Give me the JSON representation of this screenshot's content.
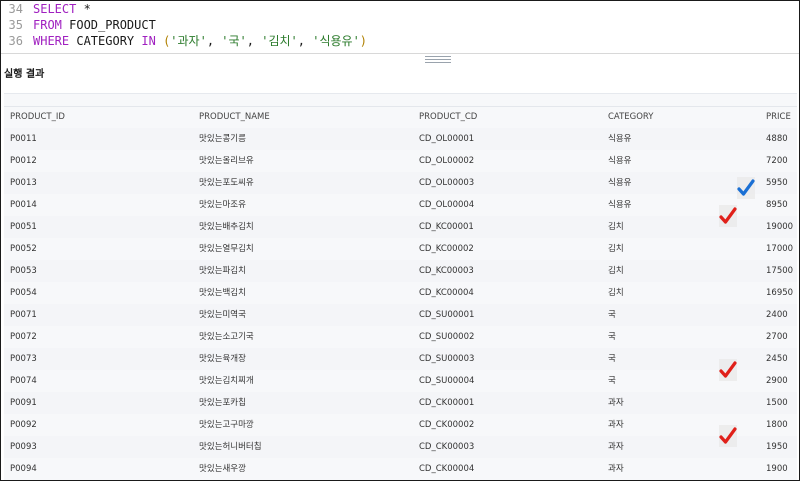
{
  "editor": {
    "lines": [
      {
        "num": "34",
        "parts": [
          {
            "t": "SELECT",
            "c": "kw"
          },
          {
            "t": " *",
            "c": "plain"
          }
        ]
      },
      {
        "num": "35",
        "parts": [
          {
            "t": "FROM",
            "c": "kw"
          },
          {
            "t": " FOOD_PRODUCT",
            "c": "plain"
          }
        ]
      },
      {
        "num": "36",
        "parts": [
          {
            "t": "WHERE",
            "c": "kw"
          },
          {
            "t": " CATEGORY ",
            "c": "plain"
          },
          {
            "t": "IN",
            "c": "kw"
          },
          {
            "t": " ",
            "c": "plain"
          },
          {
            "t": "(",
            "c": "paren"
          },
          {
            "t": "'과자'",
            "c": "str"
          },
          {
            "t": ", ",
            "c": "plain"
          },
          {
            "t": "'국'",
            "c": "str"
          },
          {
            "t": ", ",
            "c": "plain"
          },
          {
            "t": "'김치'",
            "c": "str"
          },
          {
            "t": ", ",
            "c": "plain"
          },
          {
            "t": "'식용유'",
            "c": "str"
          },
          {
            "t": ")",
            "c": "paren"
          }
        ]
      }
    ]
  },
  "results": {
    "title": "실행 결과",
    "columns": [
      "PRODUCT_ID",
      "PRODUCT_NAME",
      "PRODUCT_CD",
      "CATEGORY",
      "PRICE"
    ],
    "rows": [
      [
        "P0011",
        "맛있는콩기름",
        "CD_OL00001",
        "식용유",
        "4880"
      ],
      [
        "P0012",
        "맛있는올리브유",
        "CD_OL00002",
        "식용유",
        "7200"
      ],
      [
        "P0013",
        "맛있는포도씨유",
        "CD_OL00003",
        "식용유",
        "5950"
      ],
      [
        "P0014",
        "맛있는마조유",
        "CD_OL00004",
        "식용유",
        "8950"
      ],
      [
        "P0051",
        "맛있는배추김치",
        "CD_KC00001",
        "김치",
        "19000"
      ],
      [
        "P0052",
        "맛있는열무김치",
        "CD_KC00002",
        "김치",
        "17000"
      ],
      [
        "P0053",
        "맛있는파김치",
        "CD_KC00003",
        "김치",
        "17500"
      ],
      [
        "P0054",
        "맛있는백김치",
        "CD_KC00004",
        "김치",
        "16950"
      ],
      [
        "P0071",
        "맛있는미역국",
        "CD_SU00001",
        "국",
        "2400"
      ],
      [
        "P0072",
        "맛있는소고기국",
        "CD_SU00002",
        "국",
        "2700"
      ],
      [
        "P0073",
        "맛있는육개장",
        "CD_SU00003",
        "국",
        "2450"
      ],
      [
        "P0074",
        "맛있는김치찌개",
        "CD_SU00004",
        "국",
        "2900"
      ],
      [
        "P0091",
        "맛있는포카칩",
        "CD_CK00001",
        "과자",
        "1500"
      ],
      [
        "P0092",
        "맛있는고구마깡",
        "CD_CK00002",
        "과자",
        "1800"
      ],
      [
        "P0093",
        "맛있는허니버터칩",
        "CD_CK00003",
        "과자",
        "1950"
      ],
      [
        "P0094",
        "맛있는새우깡",
        "CD_CK00004",
        "과자",
        "1900"
      ]
    ]
  },
  "marks": [
    {
      "row": 3,
      "color": "#1a6fd4",
      "icon": "checkmark-icon"
    },
    {
      "row": 4,
      "color": "#e0201a",
      "icon": "checkmark-icon"
    },
    {
      "row": 11,
      "color": "#e0201a",
      "icon": "checkmark-icon"
    },
    {
      "row": 14,
      "color": "#e0201a",
      "icon": "checkmark-icon"
    }
  ]
}
